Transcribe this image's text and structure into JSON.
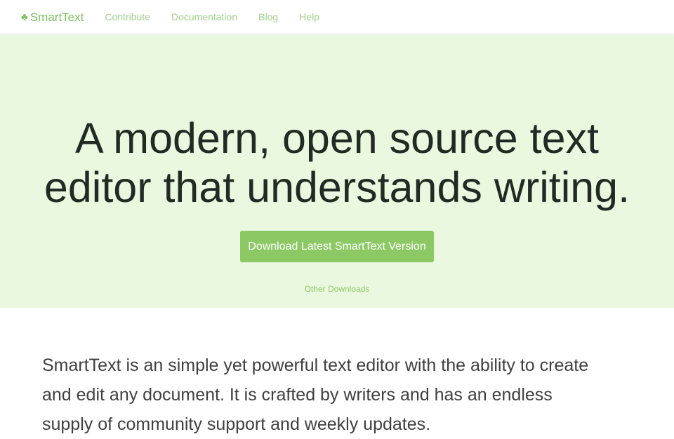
{
  "navbar": {
    "brand_icon": "♣",
    "brand_label": "SmartText",
    "links": [
      {
        "label": "Contribute"
      },
      {
        "label": "Documentation"
      },
      {
        "label": "Blog"
      },
      {
        "label": "Help"
      }
    ]
  },
  "hero": {
    "title_line1": "A modern, open source text",
    "title_line2": "editor that understands writing.",
    "download_button": "Download Latest SmartText Version",
    "other_downloads": "Other Downloads"
  },
  "intro": {
    "text": "SmartText is an simple yet powerful text editor with the ability to create and edit any document. It is crafted by writers and has an endless supply of community support and weekly updates."
  },
  "colors": {
    "accent": "#8cc965",
    "hero_background": "#ebf8e0",
    "nav_link": "#9ed089",
    "heading": "#222a24"
  }
}
